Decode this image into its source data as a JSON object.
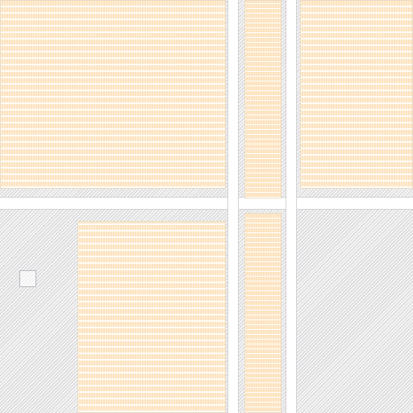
{
  "map": {
    "colors": {
      "background": "#f4f4f4",
      "hatch": "#c8c8cd",
      "road": "#ffffff",
      "road_edge": "#d2d2d6",
      "building_fill": "#fde2bd",
      "building_edge": "#e9dcc6",
      "marker_edge": "#b9b9bf"
    },
    "features": {
      "roads": [
        "horizontal-road",
        "vertical-road-left",
        "vertical-road-right"
      ],
      "buildings": [
        "building-top-left",
        "building-top-right",
        "building-strip-top",
        "building-bottom-center",
        "building-strip-bottom"
      ],
      "markers": [
        "small-square-marker"
      ]
    }
  }
}
